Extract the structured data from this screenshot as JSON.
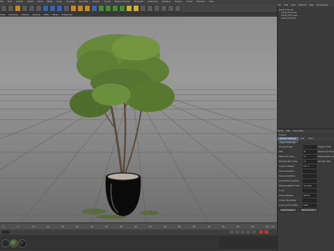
{
  "menubar": {
    "items": [
      "File",
      "Edit",
      "Create",
      "Select",
      "Tools",
      "Mesh",
      "Snap",
      "Animate",
      "Simulate",
      "Render",
      "Sculpt",
      "Motion Tracker",
      "MoGraph",
      "Character",
      "Pipeline",
      "Plugins",
      "Script",
      "Window",
      "Help"
    ]
  },
  "viewport_menu": {
    "items": [
      "View",
      "Cameras",
      "Display",
      "Options",
      "Filter",
      "Panel",
      "ProRender"
    ]
  },
  "object_manager": {
    "menu": [
      "File",
      "Edit",
      "View",
      "Objects",
      "Tags",
      "Bookmarks"
    ],
    "objects": [
      "plant_079.obj",
      "plant_079_tree",
      "plant_079_vase",
      "plant_079_soil"
    ]
  },
  "timeline": {
    "ticks": [
      "0",
      "5",
      "10",
      "15",
      "20",
      "25",
      "30",
      "35",
      "40",
      "45",
      "50",
      "55",
      "60",
      "65",
      "70",
      "75",
      "80",
      "85",
      "90"
    ],
    "end_label": "0 F"
  },
  "attributes": {
    "menu": [
      "Mode",
      "Edit",
      "User Data"
    ],
    "object_name": "Project",
    "tabs": [
      "Project Settings",
      "Info",
      "Todo",
      "Key Interpolation"
    ],
    "section": "Project Settings",
    "fields": [
      {
        "label": "Project Scale",
        "value": "1"
      },
      {
        "label": "FPS",
        "value": "30"
      },
      {
        "label": "Minimum Time",
        "value": "0 F"
      },
      {
        "label": "Preview Min Time",
        "value": "0 F"
      },
      {
        "label": "Level of Detail",
        "value": "100 %"
      },
      {
        "label": "Use Animation",
        "value": ""
      },
      {
        "label": "Use Generators",
        "value": ""
      },
      {
        "label": "Use Motion System",
        "value": ""
      },
      {
        "label": "Default Object Color",
        "value": "Gray-Blue"
      },
      {
        "label": "Color",
        "value": ""
      },
      {
        "label": "View Clipping",
        "value": "Medium"
      },
      {
        "label": "Linear Workflow",
        "value": ""
      },
      {
        "label": "Input Color Profile",
        "value": "sRGB"
      }
    ],
    "right_labels": [
      "Project Time",
      "Maximum Time",
      "Preview Max Time",
      "Render LOD"
    ],
    "buttons": [
      "Load Preset...",
      "Save Preset..."
    ]
  },
  "colors": {
    "pot": "#0b0b0b",
    "foliage": "#5d7f34",
    "trunk": "#5a4a3c",
    "accent": "#5a6f8e"
  }
}
